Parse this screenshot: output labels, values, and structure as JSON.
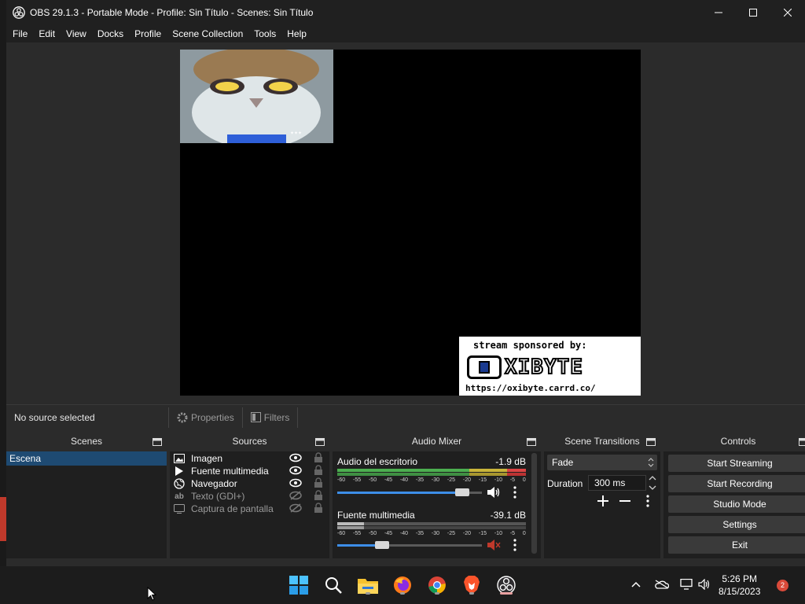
{
  "window": {
    "title": "OBS 29.1.3 - Portable Mode - Profile: Sin Título - Scenes: Sin Título",
    "controls": [
      "minimize-icon",
      "maximize-icon",
      "close-icon"
    ]
  },
  "menu": [
    "File",
    "Edit",
    "View",
    "Docks",
    "Profile",
    "Scene Collection",
    "Tools",
    "Help"
  ],
  "preview": {
    "sponsor_line": "stream sponsored by:",
    "sponsor_logo": "XIBYTE",
    "sponsor_url": "https://oxibyte.carrd.co/"
  },
  "source_toolbar": {
    "status": "No source selected",
    "properties": "Properties",
    "filters": "Filters"
  },
  "docks": {
    "scenes": {
      "title": "Scenes",
      "items": [
        "Escena"
      ]
    },
    "sources": {
      "title": "Sources",
      "items": [
        {
          "label": "Imagen",
          "icon": "image-icon",
          "visible": true
        },
        {
          "label": "Fuente multimedia",
          "icon": "play-icon",
          "visible": true
        },
        {
          "label": "Navegador",
          "icon": "globe-icon",
          "visible": true
        },
        {
          "label": "Texto (GDI+)",
          "icon": "text-icon",
          "visible": false
        },
        {
          "label": "Captura de pantalla",
          "icon": "monitor-icon",
          "visible": false
        }
      ]
    },
    "mixer": {
      "title": "Audio Mixer",
      "scale": [
        "-60",
        "-55",
        "-50",
        "-45",
        "-40",
        "-35",
        "-30",
        "-25",
        "-20",
        "-15",
        "-10",
        "-5",
        "0"
      ],
      "tracks": [
        {
          "name": "Audio del escritorio",
          "db": "-1.9 dB",
          "level": 0.92,
          "muted": false
        },
        {
          "name": "Fuente multimedia",
          "db": "-39.1 dB",
          "level": 0.3,
          "muted": true
        }
      ]
    },
    "transitions": {
      "title": "Scene Transitions",
      "selected": "Fade",
      "duration_label": "Duration",
      "duration_value": "300 ms"
    },
    "controls": {
      "title": "Controls",
      "buttons": [
        "Start Streaming",
        "Start Recording",
        "Studio Mode",
        "Settings",
        "Exit"
      ]
    }
  },
  "taskbar": {
    "apps": [
      "windows-start-icon",
      "search-icon",
      "file-explorer-icon",
      "firefox-icon",
      "chrome-icon",
      "brave-icon",
      "obs-icon"
    ],
    "time": "5:26 PM",
    "date": "8/15/2023",
    "notifications": "2"
  },
  "colors": {
    "accent": "#1e4a72",
    "slider": "#3d8ee8",
    "muted": "#c0392b"
  }
}
